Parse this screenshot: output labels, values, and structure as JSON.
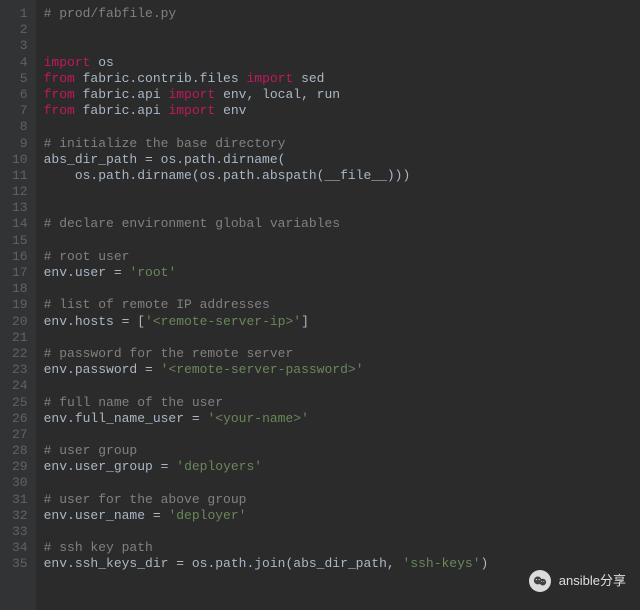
{
  "gutter": {
    "start": 1,
    "end": 35
  },
  "code": {
    "l1": {
      "comment": "# prod/fabfile.py"
    },
    "l2": {
      "blank": ""
    },
    "l3": {
      "blank": ""
    },
    "l4": {
      "kw": "import",
      "mod": " os"
    },
    "l5": {
      "kw1": "from",
      "mod1": " fabric.contrib.files ",
      "kw2": "import",
      "mod2": " sed"
    },
    "l6": {
      "kw1": "from",
      "mod1": " fabric.api ",
      "kw2": "import",
      "mod2": " env, local, run"
    },
    "l7": {
      "kw1": "from",
      "mod1": " fabric.api ",
      "kw2": "import",
      "mod2": " env"
    },
    "l8": {
      "blank": ""
    },
    "l9": {
      "comment": "# initialize the base directory"
    },
    "l10": {
      "lhs": "abs_dir_path ",
      "eq": "=",
      "rhs": " os.path.dirname("
    },
    "l11": {
      "indent": "    ",
      "rhs": "os.path.dirname(os.path.abspath(__file__)))"
    },
    "l12": {
      "blank": ""
    },
    "l13": {
      "blank": ""
    },
    "l14": {
      "comment": "# declare environment global variables"
    },
    "l15": {
      "blank": ""
    },
    "l16": {
      "comment": "# root user"
    },
    "l17": {
      "lhs": "env.user ",
      "eq": "=",
      "sp": " ",
      "str": "'root'"
    },
    "l18": {
      "blank": ""
    },
    "l19": {
      "comment": "# list of remote IP addresses"
    },
    "l20": {
      "lhs": "env.hosts ",
      "eq": "=",
      "sp": " [",
      "str": "'<remote-server-ip>'",
      "end": "]"
    },
    "l21": {
      "blank": ""
    },
    "l22": {
      "comment": "# password for the remote server"
    },
    "l23": {
      "lhs": "env.password ",
      "eq": "=",
      "sp": " ",
      "str": "'<remote-server-password>'"
    },
    "l24": {
      "blank": ""
    },
    "l25": {
      "comment": "# full name of the user"
    },
    "l26": {
      "lhs": "env.full_name_user ",
      "eq": "=",
      "sp": " ",
      "str": "'<your-name>'"
    },
    "l27": {
      "blank": ""
    },
    "l28": {
      "comment": "# user group"
    },
    "l29": {
      "lhs": "env.user_group ",
      "eq": "=",
      "sp": " ",
      "str": "'deployers'"
    },
    "l30": {
      "blank": ""
    },
    "l31": {
      "comment": "# user for the above group"
    },
    "l32": {
      "lhs": "env.user_name ",
      "eq": "=",
      "sp": " ",
      "str": "'deployer'"
    },
    "l33": {
      "blank": ""
    },
    "l34": {
      "comment": "# ssh key path"
    },
    "l35": {
      "lhs": "env.ssh_keys_dir ",
      "eq": "=",
      "rhs": " os.path.join(abs_dir_path, ",
      "str": "'ssh-keys'",
      "end": ")"
    }
  },
  "watermark": {
    "text": "ansible分享"
  }
}
